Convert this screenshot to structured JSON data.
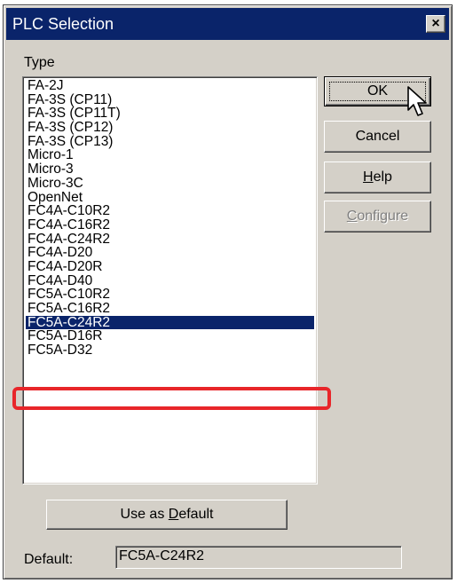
{
  "window": {
    "title": "PLC Selection",
    "close_label": "×"
  },
  "type_label": "Type",
  "plc_types": [
    "FA-2J",
    "FA-3S (CP11)",
    "FA-3S (CP11T)",
    "FA-3S (CP12)",
    "FA-3S (CP13)",
    "Micro-1",
    "Micro-3",
    "Micro-3C",
    "OpenNet",
    "FC4A-C10R2",
    "FC4A-C16R2",
    "FC4A-C24R2",
    "FC4A-D20",
    "FC4A-D20R",
    "FC4A-D40",
    "FC5A-C10R2",
    "FC5A-C16R2",
    "FC5A-C24R2",
    "FC5A-D16R",
    "FC5A-D32"
  ],
  "selected_type": "FC5A-C24R2",
  "buttons": {
    "ok": "OK",
    "cancel": "Cancel",
    "help": {
      "pre": "",
      "key": "H",
      "post": "elp"
    },
    "configure": {
      "pre": "",
      "key": "C",
      "post": "onfigure"
    },
    "use_as_default": {
      "pre": "Use as ",
      "key": "D",
      "post": "efault"
    }
  },
  "default_label": "Default:",
  "default_value": "FC5A-C24R2",
  "colors": {
    "selection": "#0a246a",
    "highlight_outline": "#e8262a",
    "dialog_face": "#d4d0c8"
  }
}
